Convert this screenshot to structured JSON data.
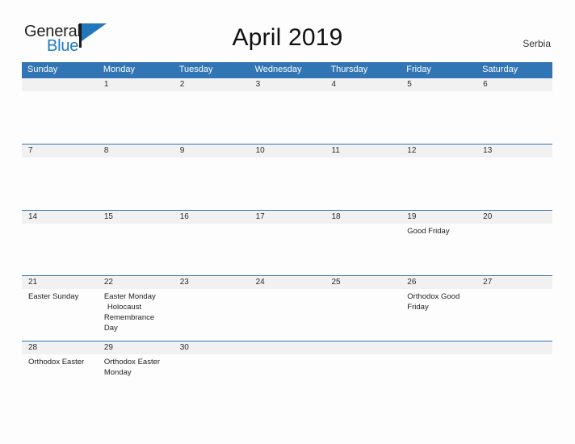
{
  "brand": {
    "name_part1": "General",
    "name_part2": "Blue",
    "flag_icon": "flag-triangle-icon"
  },
  "header": {
    "title": "April 2019",
    "region": "Serbia"
  },
  "calendar": {
    "day_headers": [
      "Sunday",
      "Monday",
      "Tuesday",
      "Wednesday",
      "Thursday",
      "Friday",
      "Saturday"
    ],
    "accent_color": "#3175b4",
    "band_color": "#f1f1f1",
    "weeks": [
      {
        "dates": [
          "",
          "1",
          "2",
          "3",
          "4",
          "5",
          "6"
        ],
        "events": [
          [],
          [],
          [],
          [],
          [],
          [],
          []
        ]
      },
      {
        "dates": [
          "7",
          "8",
          "9",
          "10",
          "11",
          "12",
          "13"
        ],
        "events": [
          [],
          [],
          [],
          [],
          [],
          [],
          []
        ]
      },
      {
        "dates": [
          "14",
          "15",
          "16",
          "17",
          "18",
          "19",
          "20"
        ],
        "events": [
          [],
          [],
          [],
          [],
          [],
          [
            "Good Friday"
          ],
          []
        ]
      },
      {
        "dates": [
          "21",
          "22",
          "23",
          "24",
          "25",
          "26",
          "27"
        ],
        "events": [
          [
            "Easter Sunday"
          ],
          [
            "Easter Monday",
            "Holocaust Remembrance Day"
          ],
          [],
          [],
          [],
          [
            "Orthodox Good Friday"
          ],
          []
        ]
      },
      {
        "dates": [
          "28",
          "29",
          "30",
          "",
          "",
          "",
          ""
        ],
        "events": [
          [
            "Orthodox Easter"
          ],
          [
            "Orthodox Easter Monday"
          ],
          [],
          [],
          [],
          [],
          []
        ]
      }
    ]
  }
}
